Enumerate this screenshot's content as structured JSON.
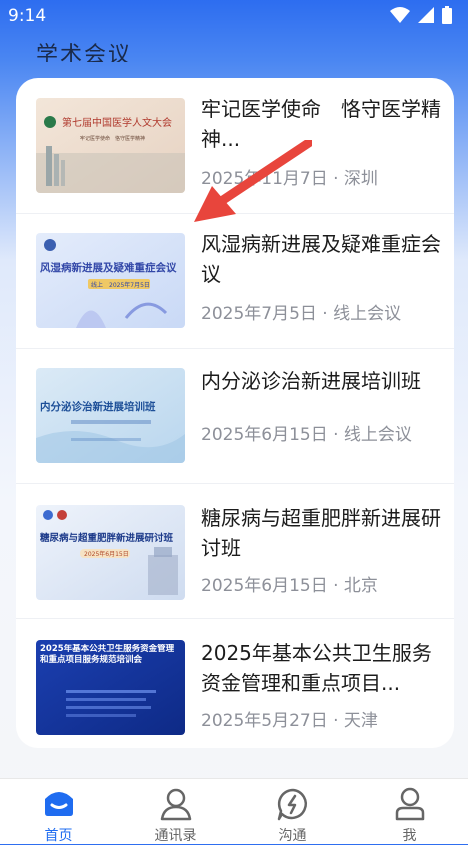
{
  "status_bar": {
    "time": "9:14"
  },
  "section": {
    "title": "学术会议"
  },
  "meetings": [
    {
      "title": "牢记医学使命　恪守医学精神...",
      "meta": "2025年11月7日 · 深圳"
    },
    {
      "title": "风湿病新进展及疑难重症会议",
      "meta": "2025年7月5日 · 线上会议"
    },
    {
      "title": "内分泌诊治新进展培训班",
      "meta": "2025年6月15日 · 线上会议"
    },
    {
      "title": "糖尿病与超重肥胖新进展研讨班",
      "meta": "2025年6月15日 · 北京"
    },
    {
      "title": "2025年基本公共卫生服务资金管理和重点项目...",
      "meta": "2025年5月27日 · 天津"
    }
  ],
  "thumbs": [
    {
      "text": "第七届中国医学人文大会",
      "sub": "牢记医学使命　恪守医学精神"
    },
    {
      "text": "风湿病新进展及疑难重症会议",
      "sub": "线上　2025年7月5日"
    },
    {
      "text": "内分泌诊治新进展培训班",
      "sub": ""
    },
    {
      "text": "糖尿病与超重肥胖新进展研讨班",
      "sub": "2025年6月15日"
    },
    {
      "text": "2025年基本公共卫生服务资金管理和重点项目服务规范培训会",
      "sub": ""
    }
  ],
  "nav": {
    "home": "首页",
    "contacts": "通讯录",
    "chat": "沟通",
    "me": "我"
  },
  "colors": {
    "accent": "#1f6cf0",
    "annotation_arrow": "#e8453c"
  }
}
